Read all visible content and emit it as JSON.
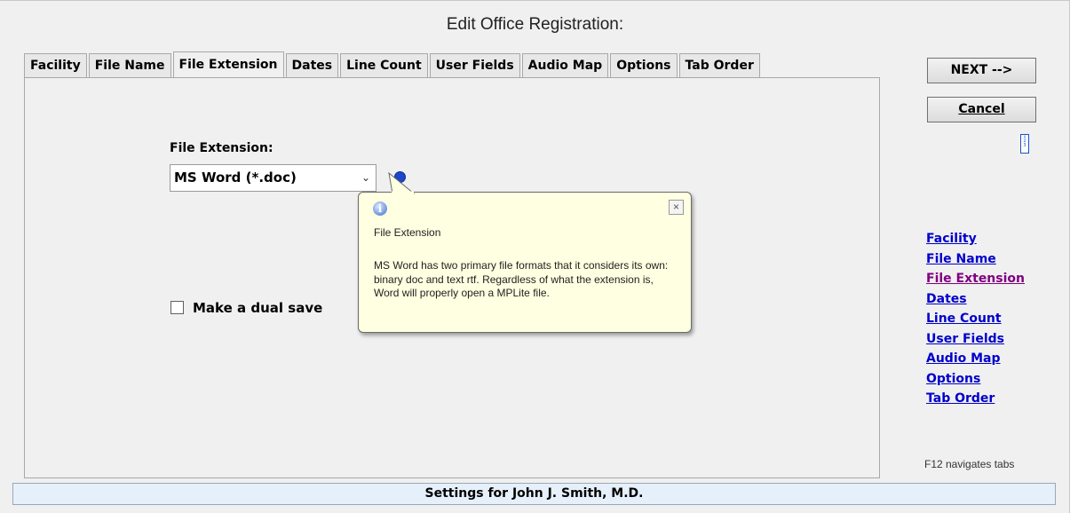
{
  "window": {
    "title": "Edit Office Registration:"
  },
  "tabs": [
    {
      "label": "Facility",
      "active": false
    },
    {
      "label": "File Name",
      "active": false
    },
    {
      "label": "File Extension",
      "active": true
    },
    {
      "label": "Dates",
      "active": false
    },
    {
      "label": "Line Count",
      "active": false
    },
    {
      "label": "User Fields",
      "active": false
    },
    {
      "label": "Audio Map",
      "active": false
    },
    {
      "label": "Options",
      "active": false
    },
    {
      "label": "Tab Order",
      "active": false
    }
  ],
  "form": {
    "file_extension_label": "File Extension:",
    "file_extension_value": "MS Word (*.doc)",
    "dual_save_label": "Make a dual save",
    "dual_save_checked": false
  },
  "tooltip": {
    "title": "File Extension",
    "body": "MS Word has two primary file formats that it considers its own: binary doc and text rtf. Regardless of what the extension is, Word will properly open a MPLite file.",
    "close_glyph": "×",
    "info_glyph": "i"
  },
  "buttons": {
    "next_label": "NEXT -->",
    "cancel_label": "Cancel"
  },
  "nav_links": [
    {
      "label": "Facility",
      "visited": false
    },
    {
      "label": "File Name",
      "visited": false
    },
    {
      "label": "File Extension",
      "visited": true
    },
    {
      "label": "Dates",
      "visited": false
    },
    {
      "label": "Line Count",
      "visited": false
    },
    {
      "label": "User Fields",
      "visited": false
    },
    {
      "label": "Audio Map",
      "visited": false
    },
    {
      "label": "Options",
      "visited": false
    },
    {
      "label": "Tab Order",
      "visited": false
    }
  ],
  "hint": "F12 navigates tabs",
  "status_bar": "Settings for John J. Smith, M.D.",
  "colors": {
    "link": "#0000cc",
    "visited_link": "#800080",
    "tooltip_bg": "#ffffe1",
    "status_bg": "#e6f0fa"
  }
}
